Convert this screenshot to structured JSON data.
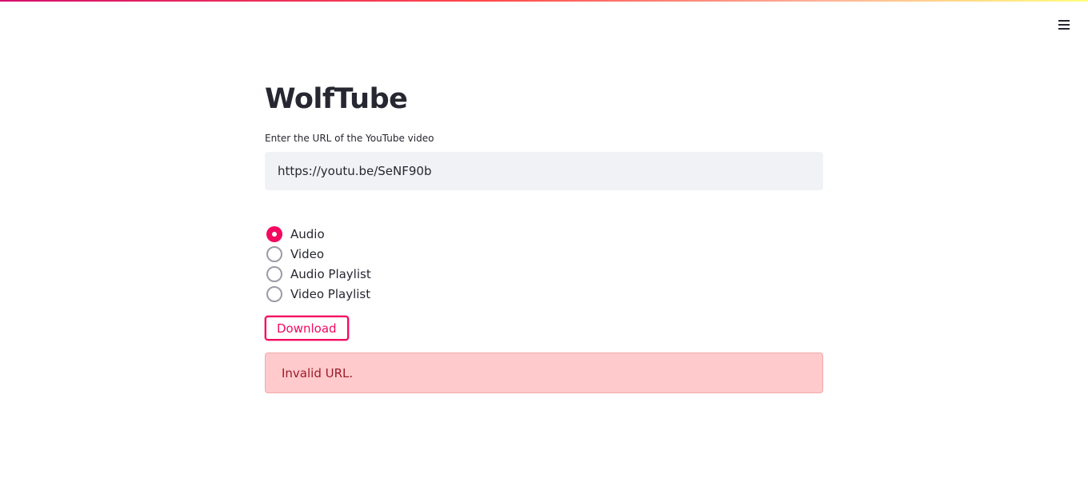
{
  "app": {
    "title": "WolfTube"
  },
  "url_field": {
    "label": "Enter the URL of the YouTube video",
    "value": "https://youtu.be/SeNF90b"
  },
  "download_type": {
    "options": [
      {
        "label": "Audio",
        "selected": true
      },
      {
        "label": "Video",
        "selected": false
      },
      {
        "label": "Audio Playlist",
        "selected": false
      },
      {
        "label": "Video Playlist",
        "selected": false
      }
    ]
  },
  "actions": {
    "download_label": "Download"
  },
  "alert": {
    "message": "Invalid URL."
  },
  "menu": {
    "icon": "hamburger-menu-icon"
  },
  "colors": {
    "accent": "#f3095f",
    "input_background": "#f0f2f6",
    "error_background": "#ffcacb",
    "error_text": "#9d1a2b",
    "text": "#262730"
  }
}
